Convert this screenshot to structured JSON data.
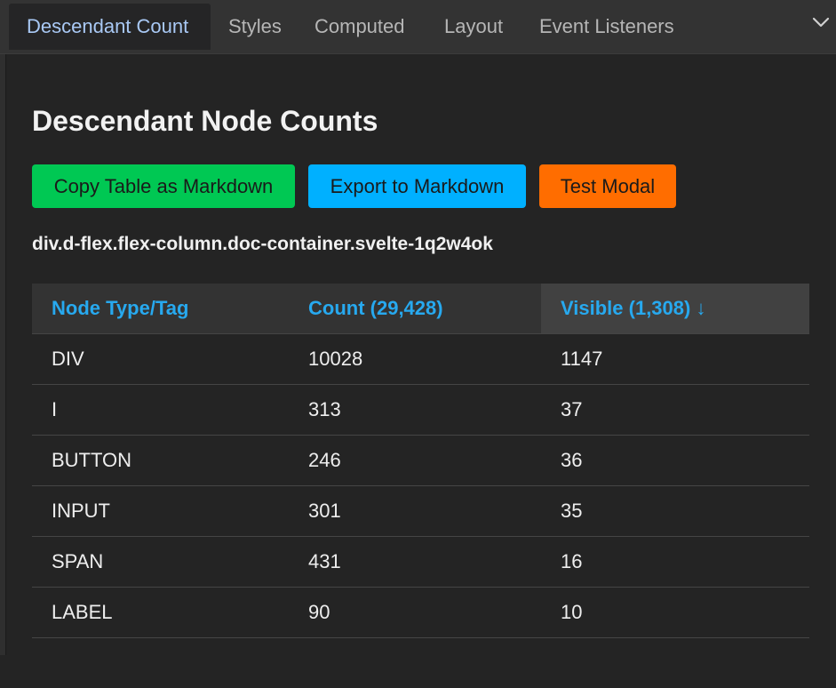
{
  "tabs": [
    {
      "label": "Descendant Count",
      "active": true
    },
    {
      "label": "Styles",
      "active": false
    },
    {
      "label": "Computed",
      "active": false
    },
    {
      "label": "Layout",
      "active": false
    },
    {
      "label": "Event Listeners",
      "active": false
    }
  ],
  "tab_overflow_icon": "chevron-down-icon",
  "page_title": "Descendant Node Counts",
  "buttons": {
    "copy_table": {
      "label": "Copy Table as Markdown",
      "color": "#00c853"
    },
    "export_markdown": {
      "label": "Export to Markdown",
      "color": "#00b0ff"
    },
    "test_modal": {
      "label": "Test Modal",
      "color": "#ff6d00"
    }
  },
  "selector": "div.d-flex.flex-column.doc-container.svelte-1q2w4ok",
  "table": {
    "headers": {
      "node_type": "Node Type/Tag",
      "count": "Count (29,428)",
      "visible": "Visible (1,308) ↓"
    },
    "sorted_column": "visible",
    "sort_direction": "descending",
    "rows": [
      {
        "tag": "DIV",
        "count": "10028",
        "visible": "1147"
      },
      {
        "tag": "I",
        "count": "313",
        "visible": "37"
      },
      {
        "tag": "BUTTON",
        "count": "246",
        "visible": "36"
      },
      {
        "tag": "INPUT",
        "count": "301",
        "visible": "35"
      },
      {
        "tag": "SPAN",
        "count": "431",
        "visible": "16"
      },
      {
        "tag": "LABEL",
        "count": "90",
        "visible": "10"
      }
    ]
  },
  "colors": {
    "accent_header_text": "#27a9ef",
    "active_tab_text": "#a9c9f5",
    "background": "#242424"
  }
}
